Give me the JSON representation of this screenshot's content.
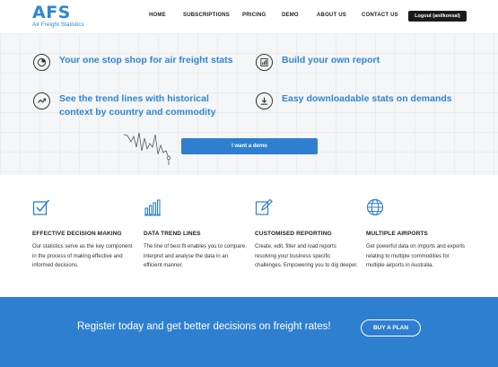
{
  "brand": {
    "name": "AFS",
    "tagline": "Air Freight Statistics"
  },
  "nav": {
    "items": [
      "HOME",
      "SUBSCRIPTIONS",
      "PRICING",
      "DEMO",
      "ABOUT US",
      "CONTACT US"
    ],
    "logout_label": "Logout (anilkonsal)"
  },
  "hero": {
    "features": [
      {
        "icon": "pie-chart-icon",
        "text": "Your one stop shop for air freight stats"
      },
      {
        "icon": "report-icon",
        "text": "Build your own report"
      },
      {
        "icon": "trend-line-icon",
        "text": "See the trend lines with historical context by country and commodity"
      },
      {
        "icon": "download-icon",
        "text": "Easy downloadable stats on demands"
      }
    ],
    "demo_button": "I want a demo"
  },
  "benefits": [
    {
      "icon": "checkbox-icon",
      "title": "EFFECTIVE DECISION MAKING",
      "description": "Our statistics serve as the key component in the process of making effective and informed decisions."
    },
    {
      "icon": "bar-chart-icon",
      "title": "DATA TREND LINES",
      "description": "The line of best fit enables you to compare, interpret and analyse the data in an efficient manner."
    },
    {
      "icon": "edit-icon",
      "title": "CUSTOMISED REPORTING",
      "description": "Create, edit, filter and load reports resolving your business specific challenges. Empowering you to dig deeper."
    },
    {
      "icon": "globe-icon",
      "title": "MULTIPLE AIRPORTS",
      "description": "Get powerful data on imports and exports relating to multiple commodities for multiple airports in Australia."
    }
  ],
  "cta": {
    "text": "Register today and get better decisions on freight rates!",
    "button": "BUY A PLAN"
  },
  "colors": {
    "accent": "#2e7fd0",
    "heading_blue": "#2e86d4",
    "dark": "#1b1b1b"
  }
}
